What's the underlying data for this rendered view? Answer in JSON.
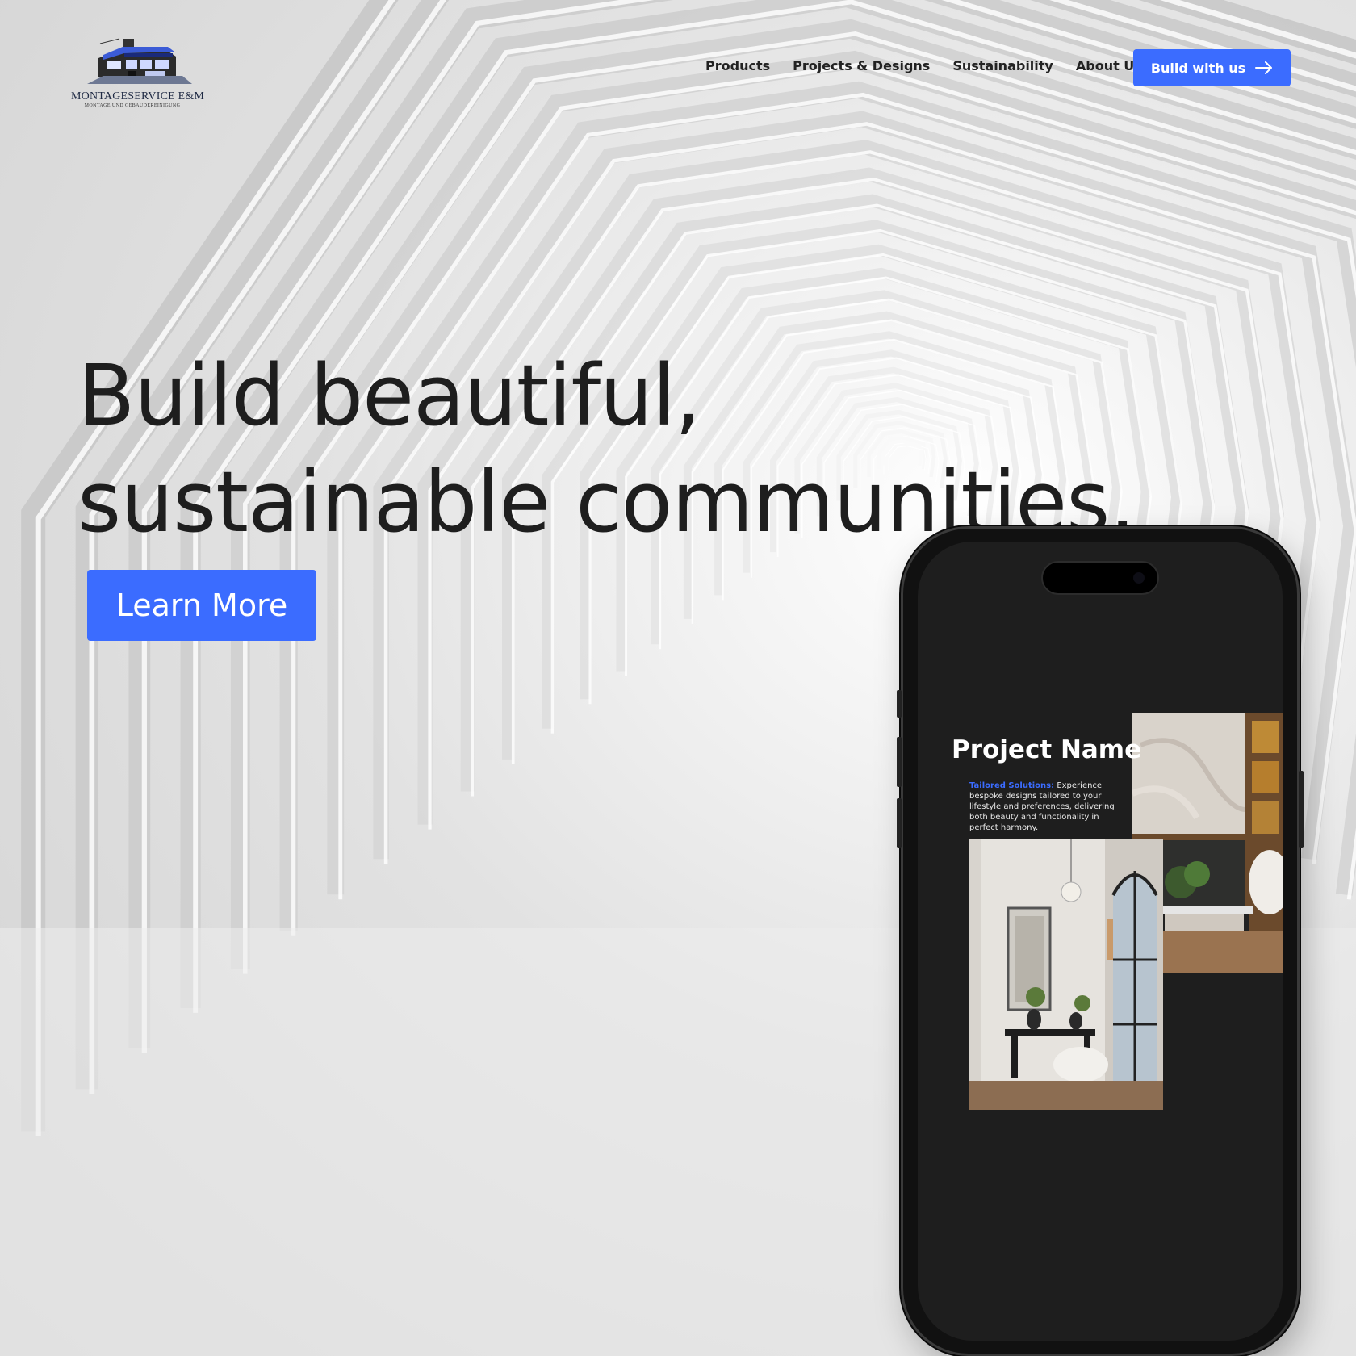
{
  "brand": {
    "name": "MONTAGESERVICE E&M",
    "tagline": "MONTAGE UND GEBÄUDEREINIGUNG",
    "accent_color": "#3b6cff"
  },
  "nav": {
    "items": [
      {
        "label": "Products"
      },
      {
        "label": "Projects & Designs"
      },
      {
        "label": "Sustainability"
      },
      {
        "label": "About Us"
      }
    ],
    "cta_label": "Build with us",
    "cta_icon": "arrow-right-icon"
  },
  "hero": {
    "title_line1": "Build beautiful,",
    "title_line2": "sustainable communities.",
    "button_label": "Learn More"
  },
  "phone": {
    "project_title": "Project Name",
    "desc_highlight": "Tailored Solutions:",
    "desc_text": " Experience bespoke designs tailored to your lifestyle and preferences, delivering both beauty and functionality in perfect harmony."
  }
}
